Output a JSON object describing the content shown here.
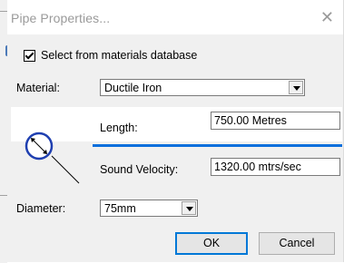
{
  "dialog": {
    "title": "Pipe Properties...",
    "close_glyph": "✕"
  },
  "materials_checkbox": {
    "label": "Select from materials database",
    "checked": true
  },
  "material": {
    "label": "Material:",
    "value": "Ductile Iron"
  },
  "length": {
    "label": "Length:",
    "value": "750.00 Metres"
  },
  "sound_velocity": {
    "label": "Sound Velocity:",
    "value": "1320.00 mtrs/sec"
  },
  "diameter": {
    "label": "Diameter:",
    "value": "75mm"
  },
  "buttons": {
    "ok": "OK",
    "cancel": "Cancel"
  },
  "colors": {
    "pipe_blue": "#0a6fdc",
    "diagram_circle": "#1f3fb0"
  }
}
